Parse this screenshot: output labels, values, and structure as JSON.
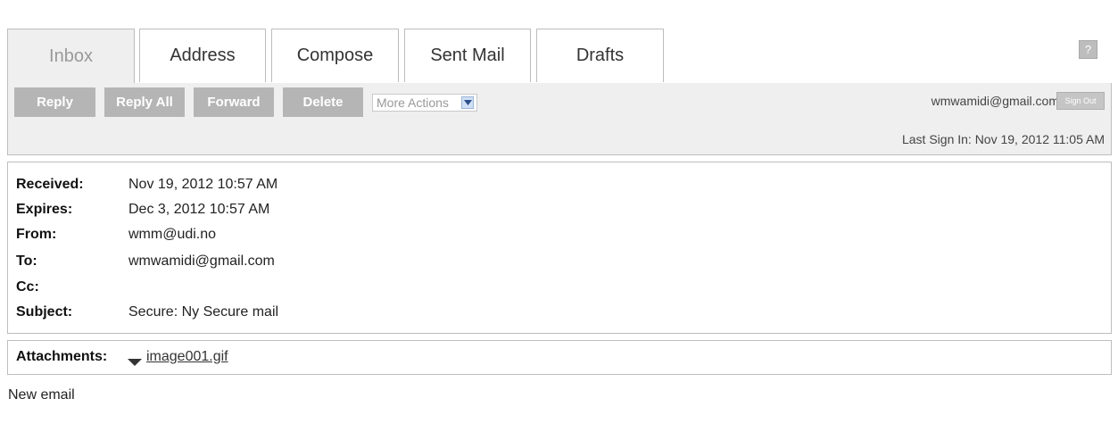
{
  "tabs": [
    {
      "label": "Inbox",
      "active": true
    },
    {
      "label": "Address"
    },
    {
      "label": "Compose"
    },
    {
      "label": "Sent Mail"
    },
    {
      "label": "Drafts"
    }
  ],
  "help": {
    "label": "?"
  },
  "toolbar": {
    "reply": "Reply",
    "reply_all": "Reply All",
    "forward": "Forward",
    "delete": "Delete",
    "more_actions": "More Actions",
    "user_email": "wmwamidi@gmail.com",
    "sign_out": "Sign Out",
    "last_sign_in": "Last Sign In: Nov 19, 2012 11:05 AM"
  },
  "message": {
    "fields": [
      {
        "label": "Received:",
        "value": "Nov 19, 2012 10:57 AM"
      },
      {
        "label": "Expires:",
        "value": "Dec 3, 2012 10:57 AM"
      },
      {
        "label": "From:",
        "value": "wmm@udi.no"
      },
      {
        "label": "To:",
        "value": "wmwamidi@gmail.com"
      },
      {
        "label": "Cc:",
        "value": ""
      },
      {
        "label": "Subject:",
        "value": "Secure: Ny Secure mail"
      }
    ],
    "attachments_label": "Attachments:",
    "attachment_file": "image001.gif",
    "body": "New email"
  },
  "colors": {
    "tab_active_bg": "#efefef",
    "button_bg": "#b5b5b5",
    "border": "#bdbdbd"
  }
}
